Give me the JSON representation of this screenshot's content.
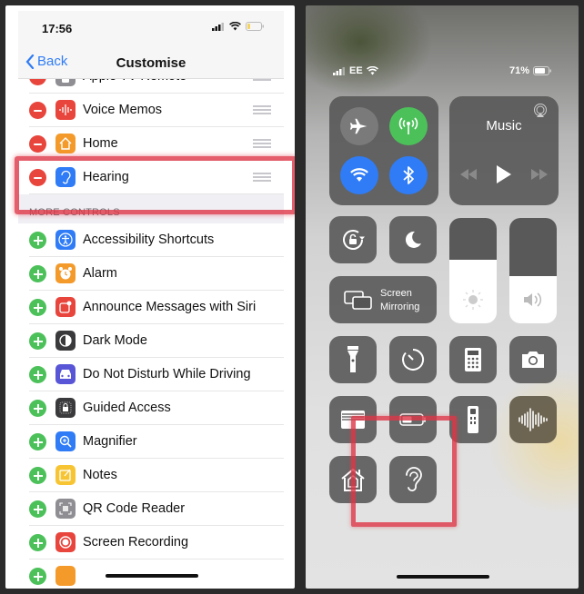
{
  "left": {
    "status_bar": {
      "time": "17:56"
    },
    "nav": {
      "back_label": "Back",
      "title": "Customise"
    },
    "included_controls": [
      {
        "label": "Apple TV Remote",
        "icon": "apple-tv-remote-icon",
        "color": "#8e8e93"
      },
      {
        "label": "Voice Memos",
        "icon": "waveform-icon",
        "color": "#e8453c"
      },
      {
        "label": "Home",
        "icon": "home-icon",
        "color": "#f39a2b"
      },
      {
        "label": "Hearing",
        "icon": "ear-icon",
        "color": "#2f7cf6"
      }
    ],
    "more_controls_header": "MORE CONTROLS",
    "more_controls": [
      {
        "label": "Accessibility Shortcuts",
        "icon": "accessibility-icon",
        "color": "#2f7cf6"
      },
      {
        "label": "Alarm",
        "icon": "alarm-clock-icon",
        "color": "#f39a2b"
      },
      {
        "label": "Announce Messages with Siri",
        "icon": "announce-messages-icon",
        "color": "#e8453c"
      },
      {
        "label": "Dark Mode",
        "icon": "dark-mode-icon",
        "color": "#3a3a3c"
      },
      {
        "label": "Do Not Disturb While Driving",
        "icon": "car-icon",
        "color": "#5856d6"
      },
      {
        "label": "Guided Access",
        "icon": "lock-icon",
        "color": "#3a3a3c"
      },
      {
        "label": "Magnifier",
        "icon": "magnifier-icon",
        "color": "#2f7cf6"
      },
      {
        "label": "Notes",
        "icon": "notes-icon",
        "color": "#f7c533"
      },
      {
        "label": "QR Code Reader",
        "icon": "qr-code-icon",
        "color": "#8e8e93"
      },
      {
        "label": "Screen Recording",
        "icon": "record-icon",
        "color": "#e8453c"
      },
      {
        "label": "",
        "icon": "partial-icon",
        "color": "#f39a2b"
      }
    ]
  },
  "right": {
    "status": {
      "carrier": "EE",
      "battery": "71%"
    },
    "connectivity": {
      "airplane": {
        "icon": "airplane-icon",
        "state": "off"
      },
      "cellular": {
        "icon": "cellular-antenna-icon",
        "state": "on"
      },
      "wifi": {
        "icon": "wifi-icon",
        "state": "on"
      },
      "bluetooth": {
        "icon": "bluetooth-icon",
        "state": "on"
      }
    },
    "music": {
      "title": "Music"
    },
    "screen_mirroring": {
      "line1": "Screen",
      "line2": "Mirroring"
    },
    "brightness_level": 0.6,
    "volume_level": 0.45,
    "colors": {
      "green": "#4cc15a",
      "blue": "#2f7cf6",
      "annotation": "#de3646"
    }
  }
}
